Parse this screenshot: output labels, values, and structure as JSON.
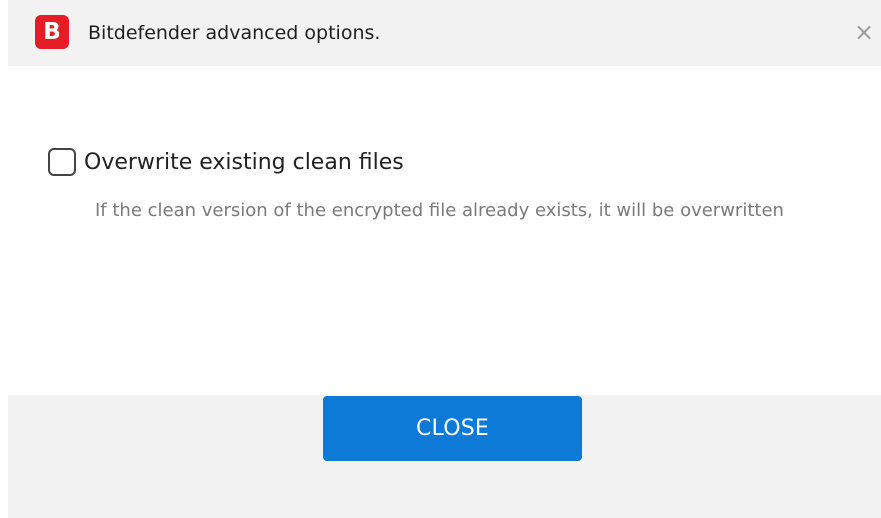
{
  "window": {
    "logo_letter": "B",
    "title": "Bitdefender advanced options.",
    "close_glyph": "×"
  },
  "option": {
    "label": "Overwrite existing clean files",
    "description": "If the clean version of the encrypted file already exists, it will be overwritten",
    "checked": false
  },
  "footer": {
    "close_label": "CLOSE"
  },
  "icons": {
    "logo": "bitdefender-logo-icon",
    "close": "close-icon",
    "checkbox": "checkbox-icon"
  },
  "colors": {
    "brand_red": "#e51d27",
    "primary_blue": "#0c7ad6",
    "titlebar_bg": "#f2f2f2",
    "description_gray": "#7a7a7a"
  }
}
